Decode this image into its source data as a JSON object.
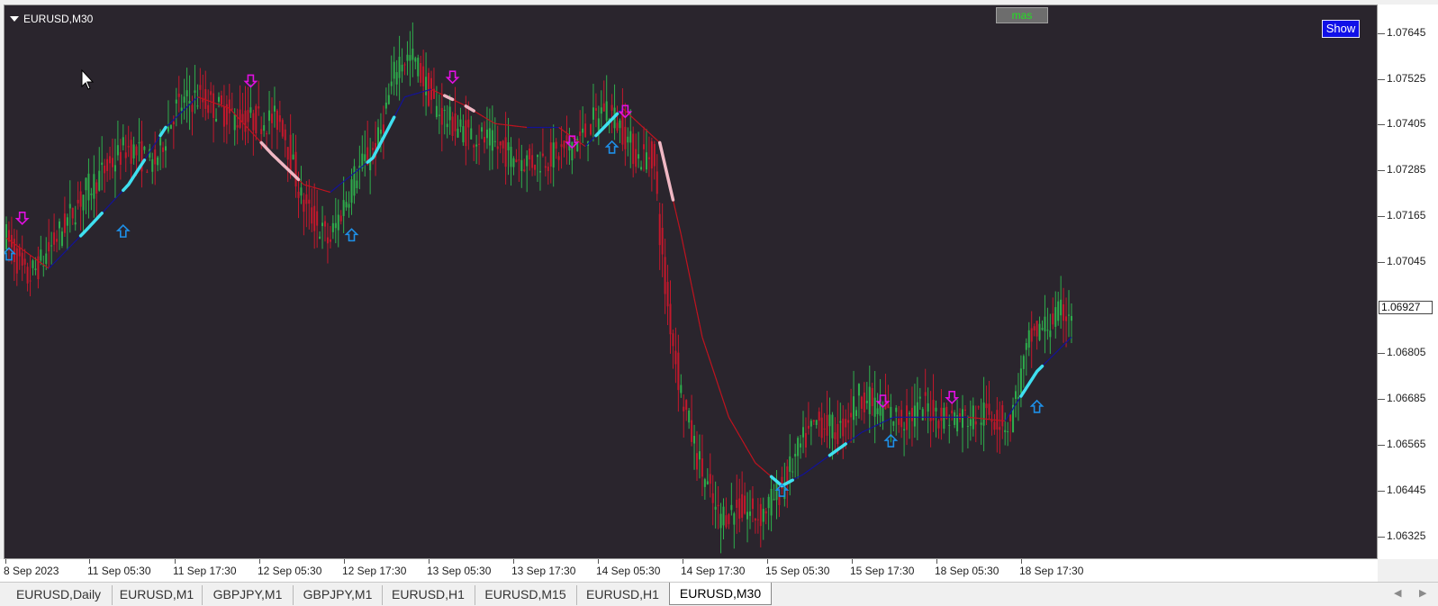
{
  "window": {
    "symbol_label": "EURUSD,M30"
  },
  "buttons": {
    "mas_label": "mas",
    "show_label": "Show"
  },
  "colors": {
    "background": "#2a252d",
    "bull_candle": "#2eae4c",
    "bear_candle": "#c4182c",
    "ma_line_down": "#c0131f",
    "ma_line_up": "#12129a",
    "ma_segment_up": "#3fe0f0",
    "ma_segment_down": "#f0b8c4",
    "ma_segment_flat": "#f0e000",
    "arrow_up": "#1e90e8",
    "arrow_down": "#e010e0"
  },
  "price_axis": {
    "labels": [
      "1.07645",
      "1.07525",
      "1.07405",
      "1.07285",
      "1.07165",
      "1.07045",
      "1.06805",
      "1.06685",
      "1.06565",
      "1.06445",
      "1.06325"
    ],
    "current_price": "1.06927"
  },
  "time_axis": {
    "labels": [
      "8 Sep 2023",
      "11 Sep 05:30",
      "11 Sep 17:30",
      "12 Sep 05:30",
      "12 Sep 17:30",
      "13 Sep 05:30",
      "13 Sep 17:30",
      "14 Sep 05:30",
      "14 Sep 17:30",
      "15 Sep 05:30",
      "15 Sep 17:30",
      "18 Sep 05:30",
      "18 Sep 17:30"
    ]
  },
  "tabs": [
    {
      "label": "EURUSD,Daily",
      "active": false
    },
    {
      "label": "EURUSD,M1",
      "active": false
    },
    {
      "label": "GBPJPY,M1",
      "active": false
    },
    {
      "label": "GBPJPY,M1",
      "active": false
    },
    {
      "label": "EURUSD,H1",
      "active": false
    },
    {
      "label": "EURUSD,M15",
      "active": false
    },
    {
      "label": "EURUSD,H1",
      "active": false
    },
    {
      "label": "EURUSD,M30",
      "active": true
    }
  ],
  "chart_data": {
    "type": "candlestick",
    "ylim": [
      1.0627,
      1.0772
    ],
    "price_anchors": [
      {
        "t": 0,
        "p": 1.0712
      },
      {
        "t": 8,
        "p": 1.07
      },
      {
        "t": 14,
        "p": 1.0705
      },
      {
        "t": 30,
        "p": 1.0723
      },
      {
        "t": 46,
        "p": 1.0735
      },
      {
        "t": 56,
        "p": 1.073
      },
      {
        "t": 64,
        "p": 1.0745
      },
      {
        "t": 72,
        "p": 1.0748
      },
      {
        "t": 80,
        "p": 1.0745
      },
      {
        "t": 88,
        "p": 1.0742
      },
      {
        "t": 96,
        "p": 1.0742
      },
      {
        "t": 104,
        "p": 1.0742
      },
      {
        "t": 112,
        "p": 1.072
      },
      {
        "t": 122,
        "p": 1.071
      },
      {
        "t": 132,
        "p": 1.0728
      },
      {
        "t": 140,
        "p": 1.0735
      },
      {
        "t": 148,
        "p": 1.0758
      },
      {
        "t": 154,
        "p": 1.0758
      },
      {
        "t": 162,
        "p": 1.0745
      },
      {
        "t": 170,
        "p": 1.074
      },
      {
        "t": 180,
        "p": 1.0737
      },
      {
        "t": 190,
        "p": 1.0733
      },
      {
        "t": 198,
        "p": 1.0731
      },
      {
        "t": 208,
        "p": 1.0733
      },
      {
        "t": 218,
        "p": 1.0738
      },
      {
        "t": 226,
        "p": 1.0746
      },
      {
        "t": 232,
        "p": 1.074
      },
      {
        "t": 238,
        "p": 1.0732
      },
      {
        "t": 244,
        "p": 1.0733
      },
      {
        "t": 248,
        "p": 1.07
      },
      {
        "t": 254,
        "p": 1.0672
      },
      {
        "t": 260,
        "p": 1.0655
      },
      {
        "t": 268,
        "p": 1.0638
      },
      {
        "t": 276,
        "p": 1.064
      },
      {
        "t": 284,
        "p": 1.0638
      },
      {
        "t": 292,
        "p": 1.0645
      },
      {
        "t": 300,
        "p": 1.0657
      },
      {
        "t": 306,
        "p": 1.0663
      },
      {
        "t": 314,
        "p": 1.066
      },
      {
        "t": 322,
        "p": 1.067
      },
      {
        "t": 330,
        "p": 1.0666
      },
      {
        "t": 338,
        "p": 1.0663
      },
      {
        "t": 346,
        "p": 1.0667
      },
      {
        "t": 354,
        "p": 1.0664
      },
      {
        "t": 362,
        "p": 1.0664
      },
      {
        "t": 370,
        "p": 1.0665
      },
      {
        "t": 378,
        "p": 1.0662
      },
      {
        "t": 386,
        "p": 1.0685
      },
      {
        "t": 392,
        "p": 1.0688
      },
      {
        "t": 397,
        "p": 1.0691
      },
      {
        "t": 401,
        "p": 1.0692
      }
    ],
    "ma_anchors": [
      {
        "t": 0,
        "p": 1.0711
      },
      {
        "t": 16,
        "p": 1.0703
      },
      {
        "t": 30,
        "p": 1.0713
      },
      {
        "t": 46,
        "p": 1.0725
      },
      {
        "t": 60,
        "p": 1.074
      },
      {
        "t": 72,
        "p": 1.0748
      },
      {
        "t": 84,
        "p": 1.0745
      },
      {
        "t": 100,
        "p": 1.0733
      },
      {
        "t": 112,
        "p": 1.0725
      },
      {
        "t": 122,
        "p": 1.0723
      },
      {
        "t": 138,
        "p": 1.0732
      },
      {
        "t": 150,
        "p": 1.0748
      },
      {
        "t": 160,
        "p": 1.075
      },
      {
        "t": 172,
        "p": 1.0746
      },
      {
        "t": 184,
        "p": 1.0741
      },
      {
        "t": 196,
        "p": 1.074
      },
      {
        "t": 208,
        "p": 1.074
      },
      {
        "t": 218,
        "p": 1.0735
      },
      {
        "t": 232,
        "p": 1.0745
      },
      {
        "t": 246,
        "p": 1.0736
      },
      {
        "t": 254,
        "p": 1.0712
      },
      {
        "t": 262,
        "p": 1.0685
      },
      {
        "t": 272,
        "p": 1.0664
      },
      {
        "t": 282,
        "p": 1.0652
      },
      {
        "t": 292,
        "p": 1.0646
      },
      {
        "t": 300,
        "p": 1.0649
      },
      {
        "t": 314,
        "p": 1.0656
      },
      {
        "t": 322,
        "p": 1.066
      },
      {
        "t": 334,
        "p": 1.0664
      },
      {
        "t": 346,
        "p": 1.0664
      },
      {
        "t": 362,
        "p": 1.0664
      },
      {
        "t": 376,
        "p": 1.0663
      },
      {
        "t": 388,
        "p": 1.0676
      },
      {
        "t": 401,
        "p": 1.0685
      }
    ],
    "ma_highlight_segments": [
      {
        "from": 28,
        "to": 36,
        "color": "up"
      },
      {
        "from": 44,
        "to": 52,
        "color": "up"
      },
      {
        "from": 58,
        "to": 60,
        "color": "up"
      },
      {
        "from": 96,
        "to": 110,
        "color": "down"
      },
      {
        "from": 136,
        "to": 146,
        "color": "up"
      },
      {
        "from": 165,
        "to": 168,
        "color": "down"
      },
      {
        "from": 173,
        "to": 176,
        "color": "down"
      },
      {
        "from": 222,
        "to": 230,
        "color": "up"
      },
      {
        "from": 246,
        "to": 251,
        "color": "down"
      },
      {
        "from": 288,
        "to": 296,
        "color": "up"
      },
      {
        "from": 310,
        "to": 316,
        "color": "up"
      },
      {
        "from": 382,
        "to": 390,
        "color": "up"
      }
    ],
    "buy_signals": [
      {
        "t": 1,
        "p": 1.071
      },
      {
        "t": 44,
        "p": 1.0716
      },
      {
        "t": 130,
        "p": 1.0715
      },
      {
        "t": 228,
        "p": 1.0738
      },
      {
        "t": 292,
        "p": 1.0648
      },
      {
        "t": 333,
        "p": 1.0661
      },
      {
        "t": 388,
        "p": 1.067
      }
    ],
    "sell_signals": [
      {
        "t": 6,
        "p": 1.0713
      },
      {
        "t": 92,
        "p": 1.0749
      },
      {
        "t": 168,
        "p": 1.075
      },
      {
        "t": 213,
        "p": 1.0733
      },
      {
        "t": 233,
        "p": 1.0741
      },
      {
        "t": 330,
        "p": 1.0665
      },
      {
        "t": 356,
        "p": 1.0666
      }
    ]
  }
}
